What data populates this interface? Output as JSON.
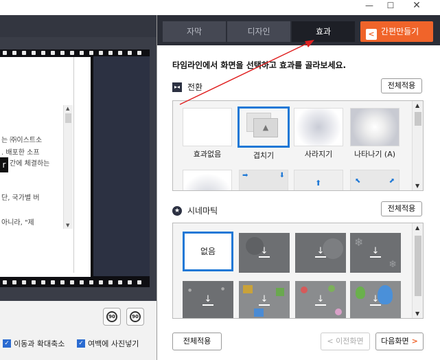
{
  "window": {
    "min_icon": "—",
    "max_icon": "☐",
    "close_icon": "✕"
  },
  "left": {
    "doc_lines": [
      "는 ㈜이스트소",
      ". 배포한 소프",
      "간에 체결하는",
      "단, 국가별 버",
      "아니라, \"제"
    ],
    "highlight_char": "r",
    "rotate_cw_label": "90",
    "rotate_ccw_label": "90",
    "check_move_zoom": "이동과 확대축소",
    "check_margin_photo": "여백에 사진넣기"
  },
  "tabs": [
    {
      "label": "자막"
    },
    {
      "label": "디자인"
    },
    {
      "label": "효과"
    }
  ],
  "quick_make": {
    "arrow": "<",
    "label": "간편만들기"
  },
  "instruction": "타임라인에서 화면을 선택하고 효과를 골라보세요.",
  "transition": {
    "label": "전환",
    "icon": "▸◂",
    "apply_all": "전체적용",
    "items": [
      {
        "caption": "효과없음"
      },
      {
        "caption": "겹치기"
      },
      {
        "caption": "사라지기"
      },
      {
        "caption": "나타나기 (A)"
      }
    ]
  },
  "cinematic": {
    "label": "시네마틱",
    "icon": "★",
    "apply_all": "전체적용",
    "none_label": "없음"
  },
  "footer": {
    "apply_all": "전체적용",
    "prev": "< 이전화면",
    "next": "다음화면",
    "next_arrow": ">"
  },
  "colors": {
    "accent_orange": "#f0642a",
    "selection_blue": "#1e78d6",
    "tab_bar": "#2b2e37",
    "annotation_red": "#e02020"
  }
}
